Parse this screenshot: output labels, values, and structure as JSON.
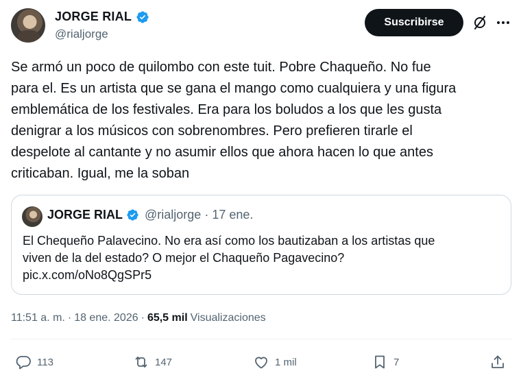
{
  "author": {
    "name": "JORGE RIAL",
    "handle": "@rialjorge"
  },
  "header": {
    "subscribe_label": "Suscribirse"
  },
  "tweet": {
    "text": "Se armó un poco de quilombo con este tuit. Pobre Chaqueño. No fue\npara el. Es un artista que se gana el mango como cualquiera y una figura\nemblemática de los festivales. Era para los boludos a los que les gusta\ndenigrar a los músicos con sobrenombres. Pero prefieren tirarle el\ndespelote al cantante y no asumir ellos que ahora hacen lo que antes\ncriticaban. Igual, me la soban"
  },
  "quote": {
    "name": "JORGE RIAL",
    "handle": "@rialjorge",
    "separator": "·",
    "date": "17 ene.",
    "text": "El Chequeño Palavecino. No era así como los bautizaban a los artistas que\nviven de la del estado? O mejor el Chaqueño Pagavecino?\npic.x.com/oNo8QgSPr5"
  },
  "meta": {
    "time": "11:51 a. m.",
    "sep1": "·",
    "date": "18 ene. 2026",
    "sep2": "·",
    "views_count": "65,5 mil",
    "views_label": "Visualizaciones"
  },
  "actions": {
    "replies": "113",
    "reposts": "147",
    "likes": "1 mil",
    "bookmarks": "7"
  },
  "icons": [
    "verified-badge-icon",
    "grok-icon",
    "more-icon",
    "reply-icon",
    "repost-icon",
    "like-icon",
    "bookmark-icon",
    "share-icon"
  ],
  "colors": {
    "text": "#0f1419",
    "secondary": "#536471",
    "verified": "#1d9bf0",
    "border": "#cfd9de"
  }
}
